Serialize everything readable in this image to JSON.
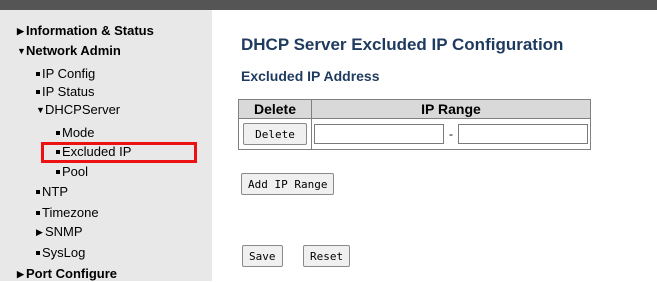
{
  "sidebar": {
    "information_status": "Information & Status",
    "network_admin": "Network Admin",
    "ip_config": "IP Config",
    "ip_status": "IP Status",
    "dhcp_server": "DHCPServer",
    "mode": "Mode",
    "excluded_ip": "Excluded IP",
    "pool": "Pool",
    "ntp": "NTP",
    "timezone": "Timezone",
    "snmp": "SNMP",
    "syslog": "SysLog",
    "port_configure": "Port Configure"
  },
  "main": {
    "title": "DHCP Server Excluded IP Configuration",
    "subtitle": "Excluded IP Address",
    "table": {
      "col_delete": "Delete",
      "col_ip_range": "IP Range",
      "row_delete_button": "Delete",
      "range_separator": "-",
      "ip_start": "",
      "ip_end": ""
    },
    "add_ip_range": "Add IP Range",
    "save": "Save",
    "reset": "Reset"
  },
  "colors": {
    "title": "#1f3a5f",
    "highlight_border": "#ee1111",
    "sidebar_bg": "#e8e8e8",
    "topbar": "#555555"
  }
}
